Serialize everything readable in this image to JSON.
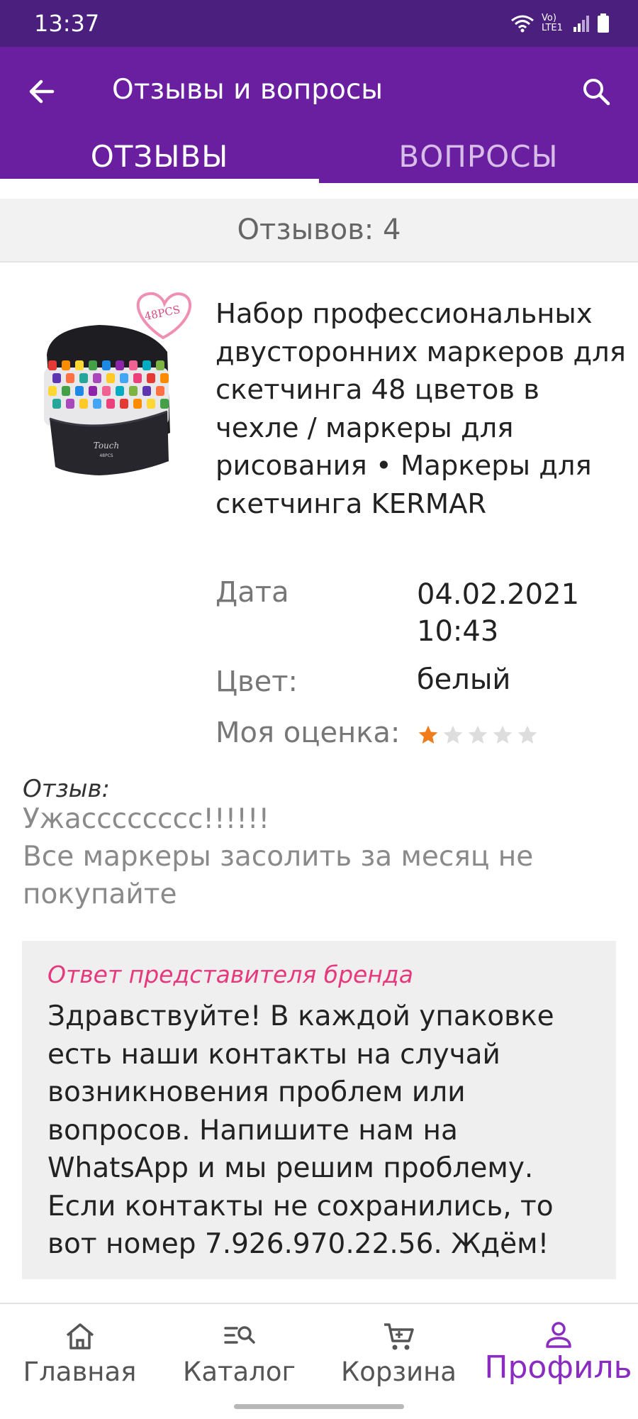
{
  "status_bar": {
    "time": "13:37",
    "network": "Vo) LTE1"
  },
  "app_bar": {
    "title": "Отзывы и вопросы"
  },
  "tabs": [
    {
      "label": "ОТЗЫВЫ",
      "active": true
    },
    {
      "label": "ВОПРОСЫ",
      "active": false
    }
  ],
  "review_count": "Отзывов: 4",
  "product": {
    "image_badge": "48PCS",
    "title": "Набор профессиональных двусторонних маркеров для скетчинга 48 цветов в чехле / маркеры для рисования • Маркеры для скетчинга KERMAR"
  },
  "meta": {
    "date_label": "Дата",
    "date_value": "04.02.2021",
    "time_value": "10:43",
    "color_label": "Цвет:",
    "color_value": "белый",
    "rating_label": "Моя оценка:",
    "rating": 1,
    "rating_max": 5
  },
  "review": {
    "label": "Отзыв:",
    "line1": "Ужасссссссс!!!!!!",
    "line2": "Все маркеры засолить за месяц не покупайте"
  },
  "brand_answer": {
    "label": "Ответ представителя бренда",
    "text": "Здравствуйте! В каждой упаковке есть наши контакты на случай возникновения проблем или вопросов. Напишите нам на WhatsApp и мы решим проблему. Если контакты не сохранились, то вот номер 7.926.970.22.56. Ждём!"
  },
  "bottom_nav": [
    {
      "label": "Главная",
      "icon": "home-icon"
    },
    {
      "label": "Каталог",
      "icon": "catalog-search-icon"
    },
    {
      "label": "Корзина",
      "icon": "cart-icon"
    },
    {
      "label": "Профиль",
      "icon": "profile-icon",
      "active": true
    }
  ],
  "colors": {
    "status_bar": "#4b1f7e",
    "app_bar": "#6a1fa0",
    "accent_active_nav": "#8b2cc0",
    "brand_answer_label": "#e6397d",
    "star_filled": "#f07c1c",
    "star_empty": "#dddddd"
  }
}
